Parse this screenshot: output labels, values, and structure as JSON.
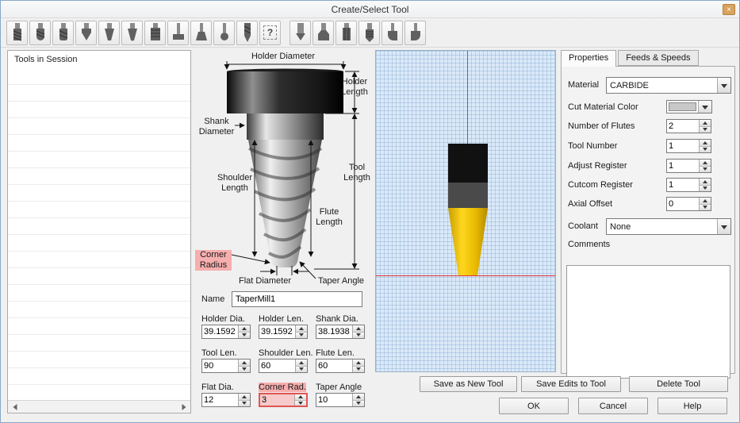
{
  "window": {
    "title": "Create/Select Tool",
    "close_glyph": "×"
  },
  "toolbar": {
    "custom_glyph": "?",
    "icons": [
      "flat-end-mill",
      "ball-end-mill",
      "bull-nose-mill",
      "v-bit",
      "taper-flat-mill",
      "taper-ball-mill",
      "thread-mill",
      "t-slot-cutter",
      "dovetail-cutter",
      "lollipop-cutter",
      "drill",
      "custom-tool",
      "spot-drill",
      "chamfer-mill",
      "reamer",
      "tap",
      "corner-rounding-left",
      "corner-rounding-right"
    ]
  },
  "left_panel": {
    "header": "Tools in Session"
  },
  "diagram": {
    "holder_diameter": "Holder Diameter",
    "holder_length": "Holder Length",
    "shank_diameter": "Shank Diameter",
    "shoulder_length": "Shoulder Length",
    "tool_length": "Tool Length",
    "flute_length": "Flute Length",
    "corner_radius": "Corner Radius",
    "flat_diameter": "Flat Diameter",
    "taper_angle": "Taper Angle"
  },
  "name_field": {
    "label": "Name",
    "value": "TaperMill1"
  },
  "dimensions": {
    "holder_dia": {
      "label": "Holder Dia.",
      "value": "39.1592"
    },
    "holder_len": {
      "label": "Holder Len.",
      "value": "39.1592"
    },
    "shank_dia": {
      "label": "Shank Dia.",
      "value": "38.1938"
    },
    "tool_len": {
      "label": "Tool Len.",
      "value": "90"
    },
    "shoulder_len": {
      "label": "Shoulder Len.",
      "value": "60"
    },
    "flute_len": {
      "label": "Flute Len.",
      "value": "60"
    },
    "flat_dia": {
      "label": "Flat Dia.",
      "value": "12"
    },
    "corner_rad": {
      "label": "Corner Rad.",
      "value": "3"
    },
    "taper_angle": {
      "label": "Taper Angle",
      "value": "10"
    }
  },
  "properties_panel": {
    "tab_properties": "Properties",
    "tab_feeds": "Feeds & Speeds",
    "material": {
      "label": "Material",
      "value": "CARBIDE"
    },
    "cut_material_color": {
      "label": "Cut Material Color",
      "swatch_color": "#c8c8c8"
    },
    "number_of_flutes": {
      "label": "Number of Flutes",
      "value": "2"
    },
    "tool_number": {
      "label": "Tool Number",
      "value": "1"
    },
    "adjust_register": {
      "label": "Adjust Register",
      "value": "1"
    },
    "cutcom_register": {
      "label": "Cutcom Register",
      "value": "1"
    },
    "axial_offset": {
      "label": "Axial Offset",
      "value": "0"
    },
    "coolant": {
      "label": "Coolant",
      "value": "None"
    },
    "comments_label": "Comments"
  },
  "actions": {
    "save_as_new": "Save as New Tool",
    "save_edits": "Save Edits to Tool",
    "delete_tool": "Delete Tool",
    "ok": "OK",
    "cancel": "Cancel",
    "help": "Help"
  },
  "colors": {
    "highlight_bg": "#f6aeae",
    "highlight_border": "#e05555",
    "tool_yellow": "#f5c500",
    "axis_green": "#0aa54a",
    "axis_red": "#e23434",
    "grid_bg": "#dbe9f8",
    "grid_line": "#b7d0ea"
  }
}
